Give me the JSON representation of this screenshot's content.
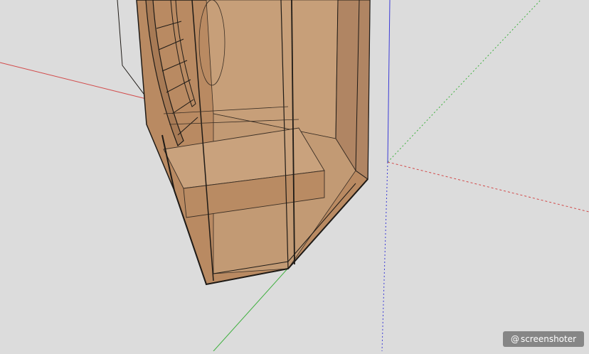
{
  "watermark": {
    "symbol": "@",
    "text": "screenshoter"
  },
  "colors": {
    "background": "#dcdcdc",
    "axis_red": "#d24a4a",
    "axis_green": "#3fb03f",
    "axis_blue": "#3b3bd6",
    "wood_light": "#c79f79",
    "wood_mid": "#b98a62",
    "wood_dark": "#a77a55",
    "edge": "#1e1a16"
  },
  "icons": {
    "watermark_badge": "at-sign-icon"
  }
}
